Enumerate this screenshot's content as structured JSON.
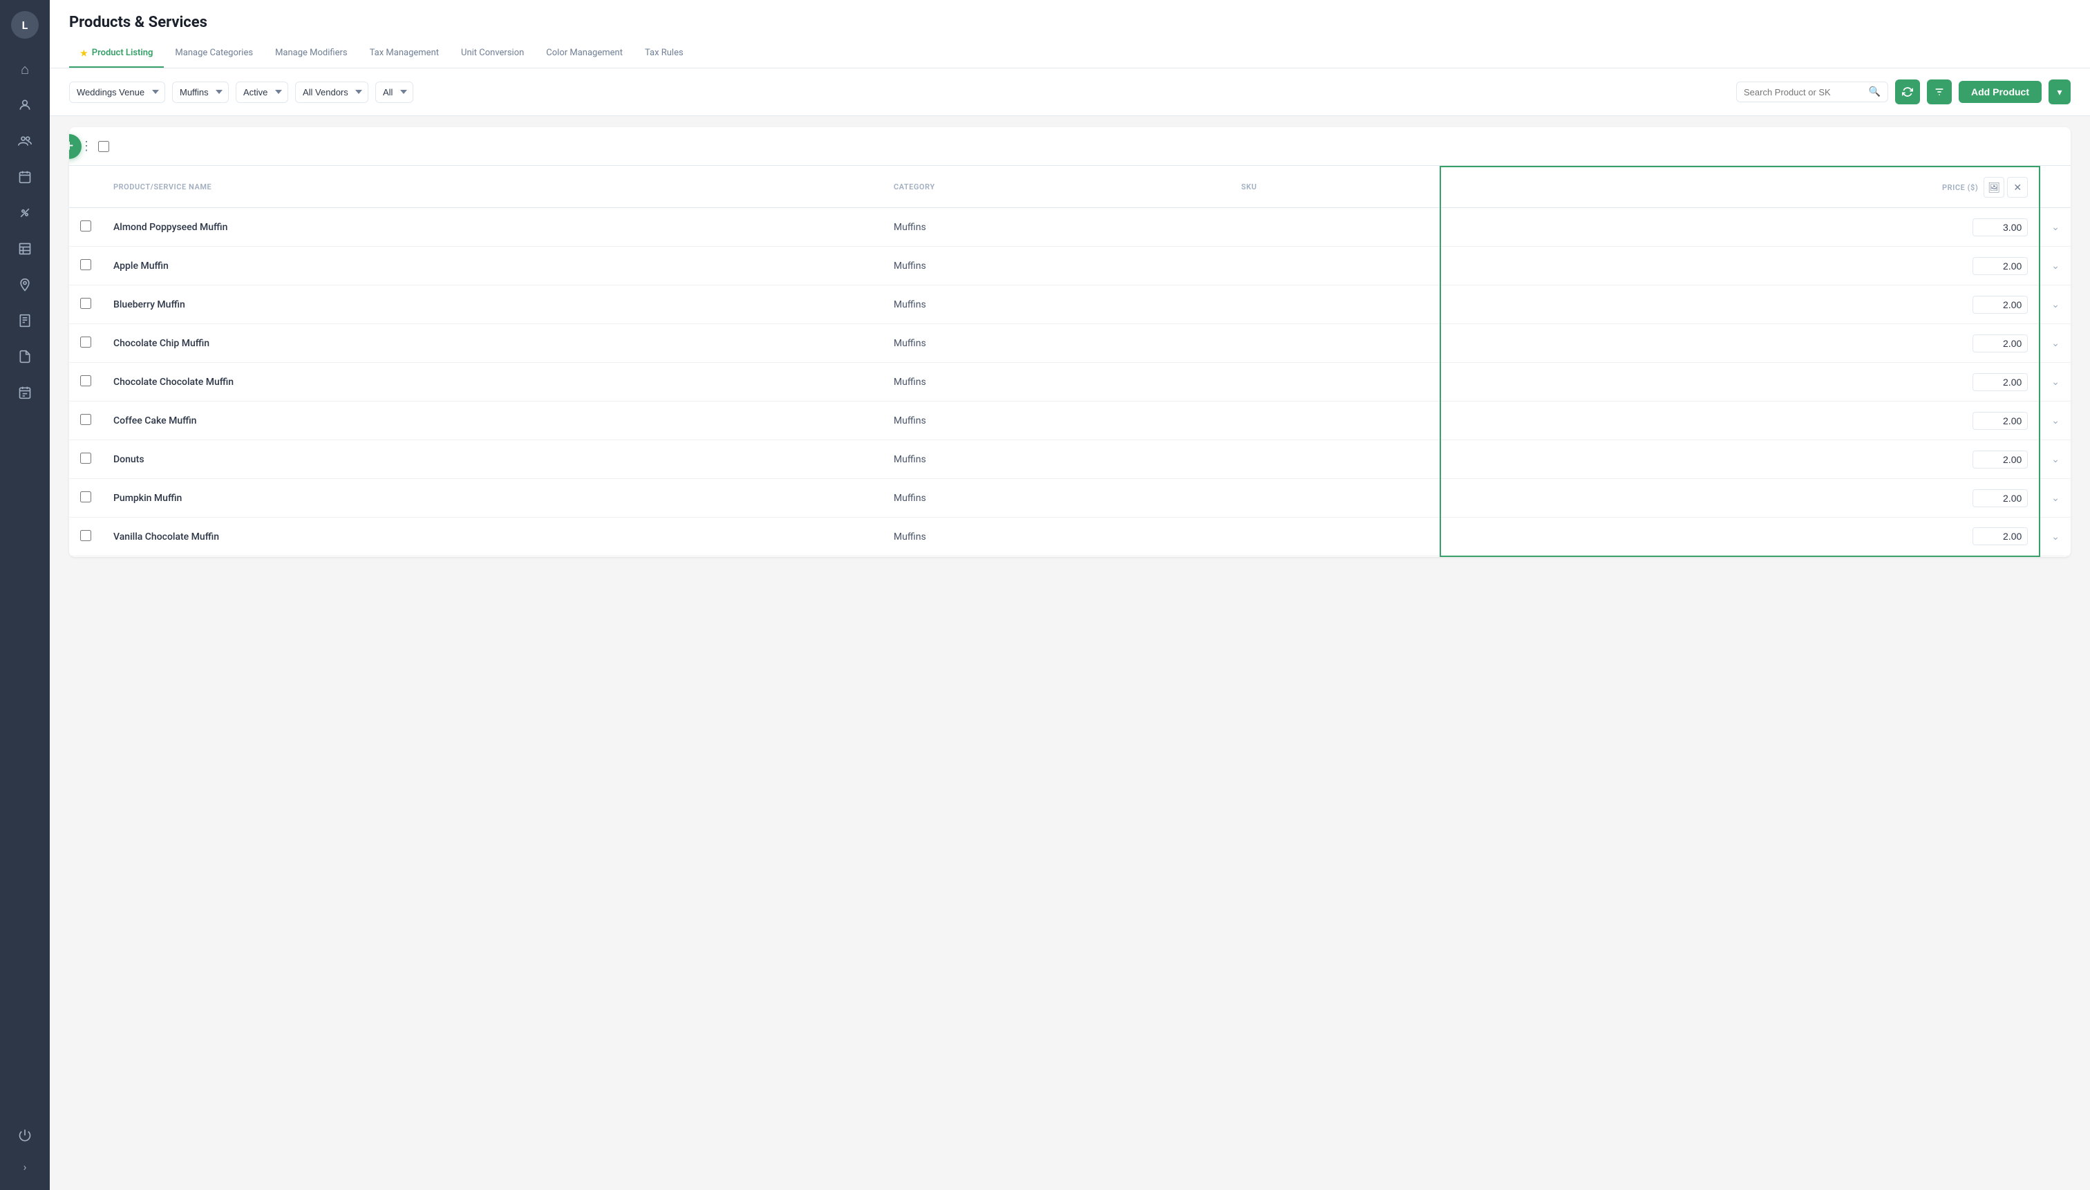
{
  "app": {
    "title": "Products & Services",
    "user_initial": "L"
  },
  "sidebar": {
    "items": [
      {
        "name": "home",
        "icon": "⌂",
        "active": false
      },
      {
        "name": "users",
        "icon": "👥",
        "active": false
      },
      {
        "name": "team",
        "icon": "👨‍👩‍👧",
        "active": false
      },
      {
        "name": "calendar",
        "icon": "📅",
        "active": false
      },
      {
        "name": "discount",
        "icon": "％",
        "active": false
      },
      {
        "name": "reports",
        "icon": "📊",
        "active": false
      },
      {
        "name": "location",
        "icon": "📍",
        "active": false
      },
      {
        "name": "invoice",
        "icon": "🧾",
        "active": false
      },
      {
        "name": "document",
        "icon": "📄",
        "active": false
      },
      {
        "name": "schedule",
        "icon": "🗓",
        "active": false
      }
    ]
  },
  "tabs": [
    {
      "label": "Product Listing",
      "active": true,
      "has_icon": true
    },
    {
      "label": "Manage Categories",
      "active": false,
      "has_icon": false
    },
    {
      "label": "Manage Modifiers",
      "active": false,
      "has_icon": false
    },
    {
      "label": "Tax Management",
      "active": false,
      "has_icon": false
    },
    {
      "label": "Unit Conversion",
      "active": false,
      "has_icon": false
    },
    {
      "label": "Color Management",
      "active": false,
      "has_icon": false
    },
    {
      "label": "Tax Rules",
      "active": false,
      "has_icon": false
    }
  ],
  "filters": {
    "venue": "Weddings Venue",
    "category": "Muffins",
    "status": "Active",
    "vendor": "All Vendors",
    "type": "All",
    "search_placeholder": "Search Product or SK"
  },
  "toolbar": {
    "add_product_label": "Add Product"
  },
  "table": {
    "columns": {
      "product_name": "PRODUCT/SERVICE NAME",
      "category": "CATEGORY",
      "sku": "SKU",
      "price": "PRICE ($)"
    },
    "rows": [
      {
        "name": "Almond Poppyseed Muffin",
        "category": "Muffins",
        "sku": "",
        "price": "3.00"
      },
      {
        "name": "Apple Muffin",
        "category": "Muffins",
        "sku": "",
        "price": "2.00"
      },
      {
        "name": "Blueberry Muffin",
        "category": "Muffins",
        "sku": "",
        "price": "2.00"
      },
      {
        "name": "Chocolate Chip Muffin",
        "category": "Muffins",
        "sku": "",
        "price": "2.00"
      },
      {
        "name": "Chocolate Chocolate Muffin",
        "category": "Muffins",
        "sku": "",
        "price": "2.00"
      },
      {
        "name": "Coffee Cake Muffin",
        "category": "Muffins",
        "sku": "",
        "price": "2.00"
      },
      {
        "name": "Donuts",
        "category": "Muffins",
        "sku": "",
        "price": "2.00"
      },
      {
        "name": "Pumpkin Muffin",
        "category": "Muffins",
        "sku": "",
        "price": "2.00"
      },
      {
        "name": "Vanilla Chocolate Muffin",
        "category": "Muffins",
        "sku": "",
        "price": "2.00"
      }
    ]
  }
}
